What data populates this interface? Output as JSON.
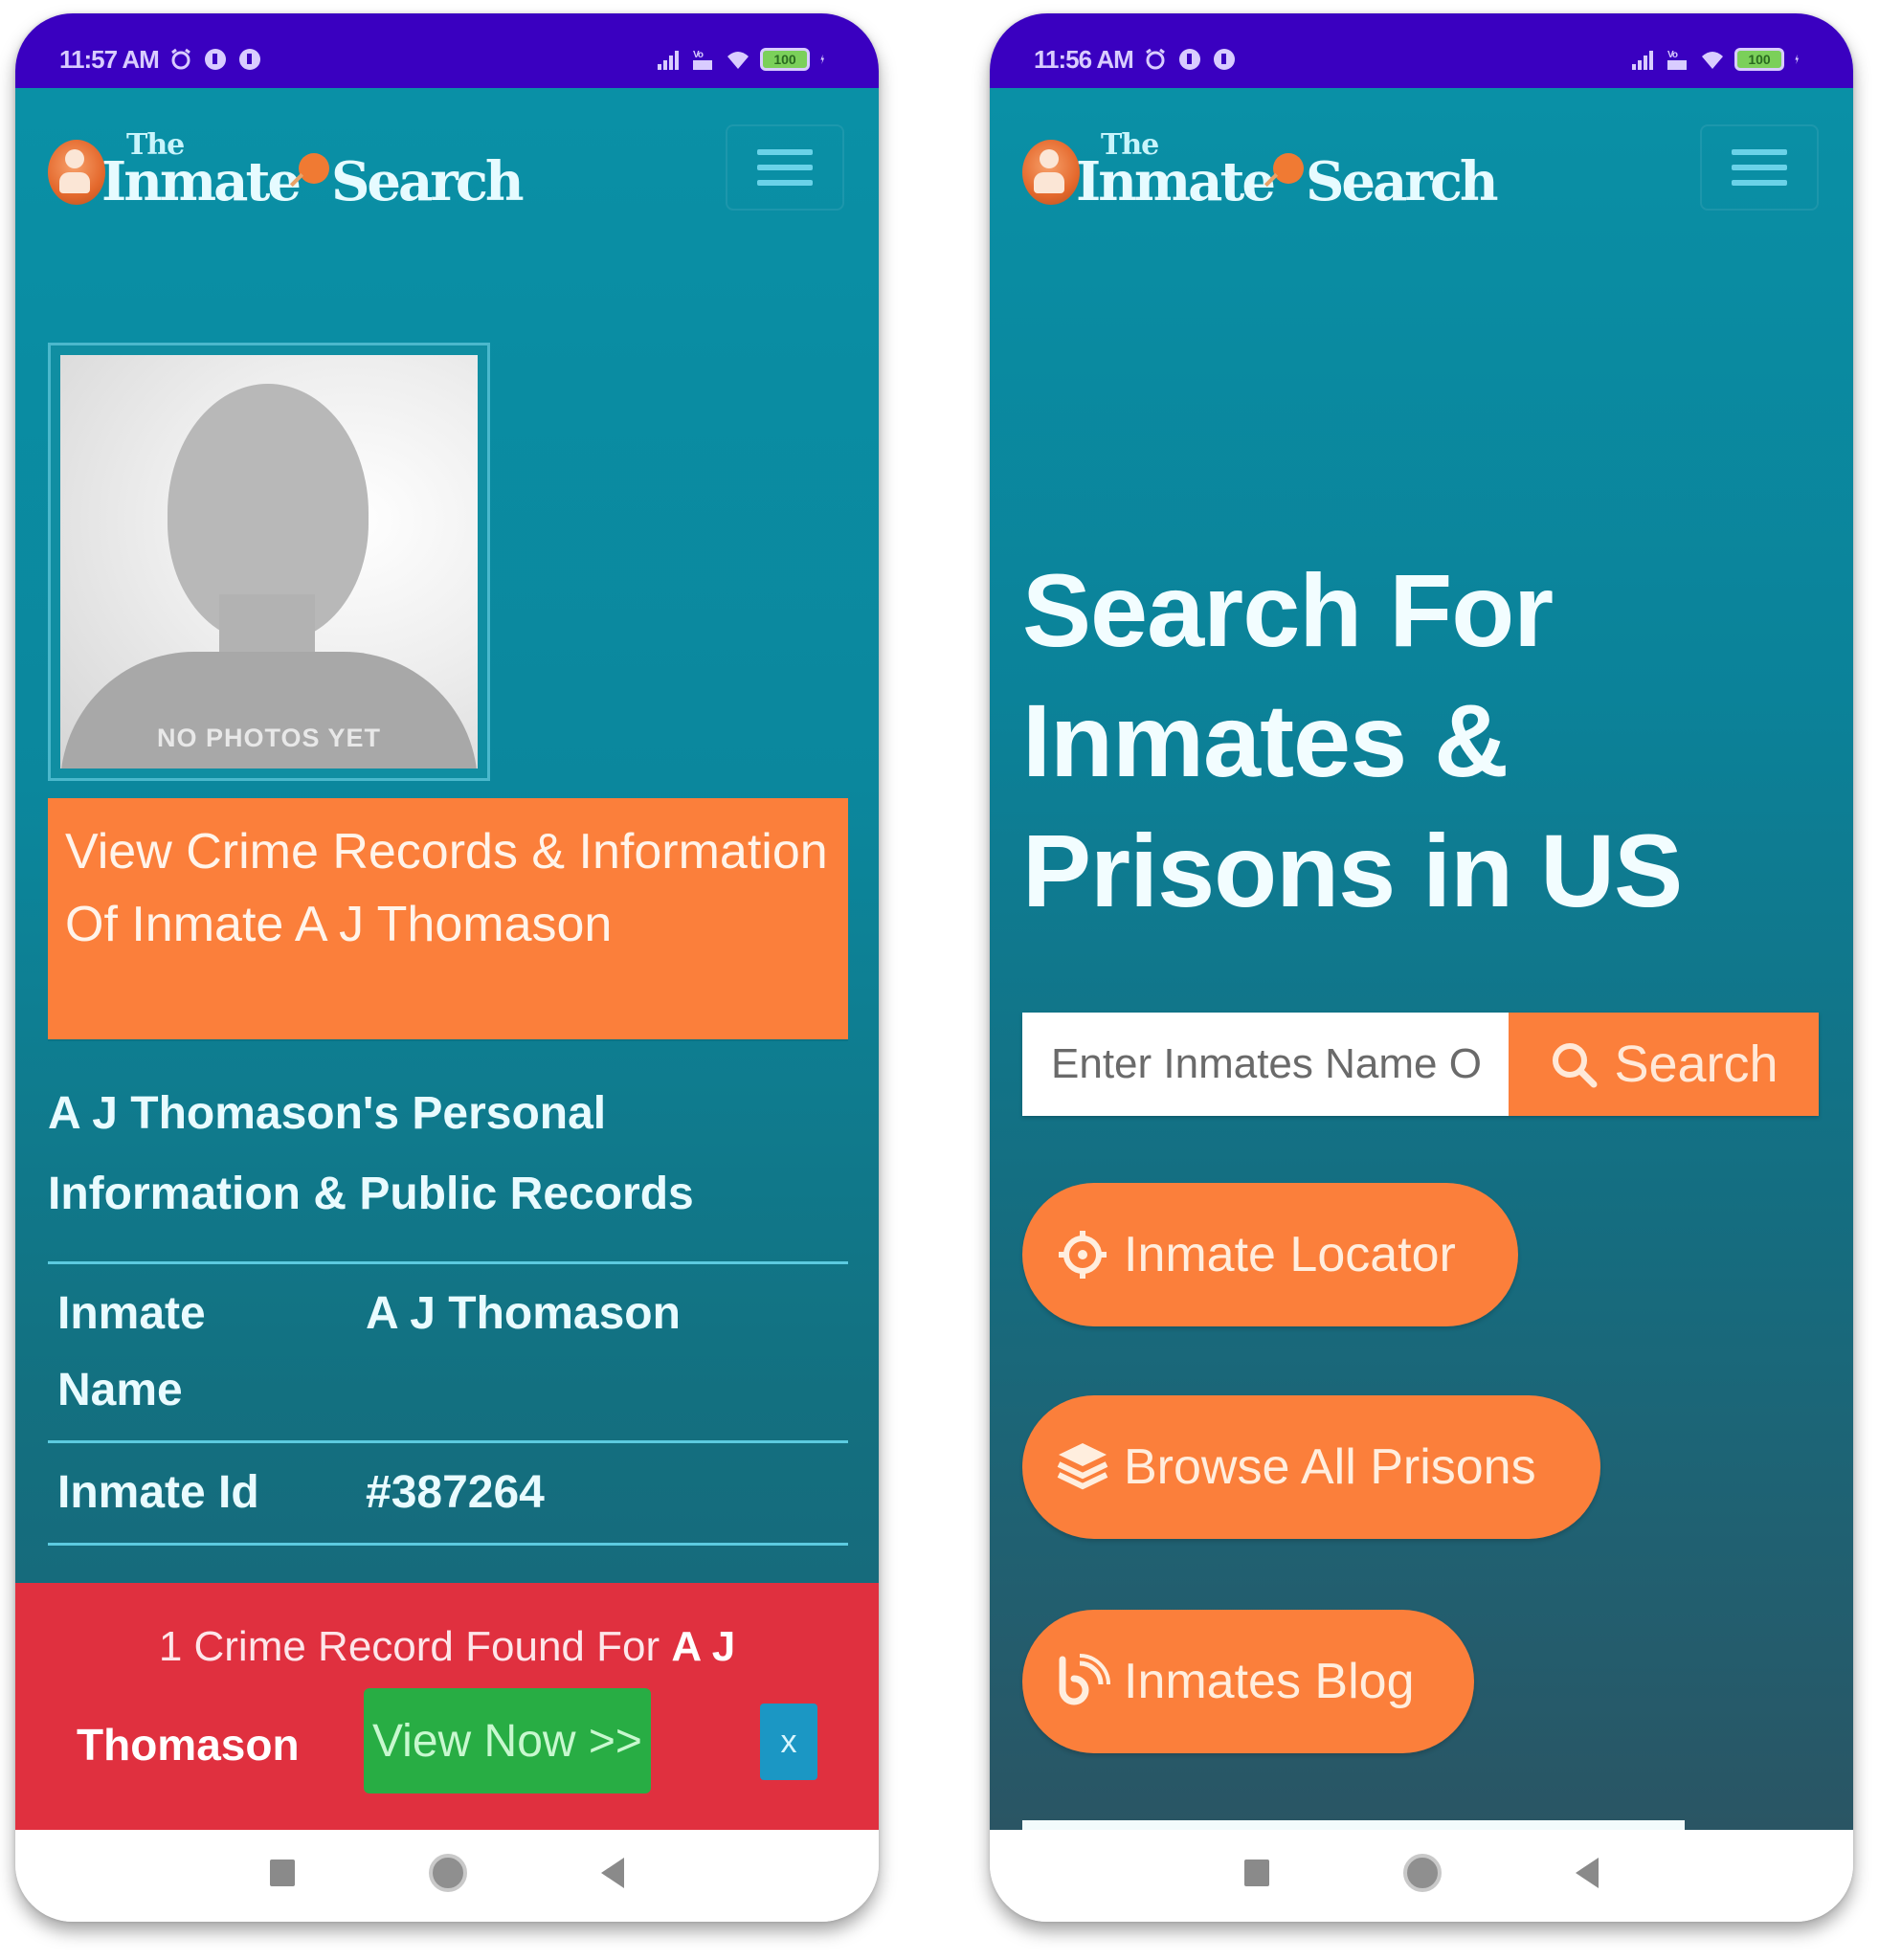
{
  "colors": {
    "status_bar": "#3a00c0",
    "teal_background": "#0a90a6",
    "orange_accent": "#fb7f3b",
    "alert_red": "#e0303f",
    "view_now_green": "#28ad44",
    "close_blue": "#1b97c4"
  },
  "left_phone": {
    "status_bar": {
      "time": "11:57 AM",
      "left_icons": [
        "alarm-icon",
        "notification-icon",
        "notification-icon"
      ],
      "right_icons": [
        "signal-icon",
        "vowifi-icon",
        "wifi-icon",
        "battery-icon",
        "charging-icon"
      ],
      "battery": "100"
    },
    "header": {
      "logo_small": "The",
      "logo_word1": "Inmate",
      "logo_word2": "Search",
      "menu_icon": "hamburger-icon"
    },
    "photo": {
      "caption": "NO PHOTOS YET"
    },
    "crime_banner": "View Crime Records & Information Of Inmate A J Thomason",
    "section_heading": "A J Thomason's Personal Information & Public Records",
    "info_table": [
      {
        "label": "Inmate Name",
        "value": "A J Thomason"
      },
      {
        "label": "Inmate Id",
        "value": "#387264"
      }
    ],
    "alert": {
      "text_prefix": "1 Crime Record Found For ",
      "name_first": "A J",
      "name_last": "Thomason",
      "view_button": "View Now >>",
      "close_button": "x"
    },
    "nav": [
      "recents-button",
      "home-button",
      "back-button"
    ]
  },
  "right_phone": {
    "status_bar": {
      "time": "11:56 AM",
      "left_icons": [
        "alarm-icon",
        "notification-icon",
        "notification-icon"
      ],
      "right_icons": [
        "signal-icon",
        "vowifi-icon",
        "wifi-icon",
        "battery-icon",
        "charging-icon"
      ],
      "battery": "100"
    },
    "header": {
      "logo_small": "The",
      "logo_word1": "Inmate",
      "logo_word2": "Search",
      "menu_icon": "hamburger-icon"
    },
    "hero_title": "Search For Inmates & Prisons in US",
    "search": {
      "placeholder": "Enter Inmates Name Or Id",
      "button_label": "Search",
      "button_icon": "search-icon"
    },
    "links": [
      {
        "label": "Inmate Locator",
        "icon": "crosshair-icon"
      },
      {
        "label": "Browse All Prisons",
        "icon": "layers-icon"
      },
      {
        "label": "Inmates Blog",
        "icon": "blog-icon"
      }
    ],
    "nav": [
      "recents-button",
      "home-button",
      "back-button"
    ]
  }
}
